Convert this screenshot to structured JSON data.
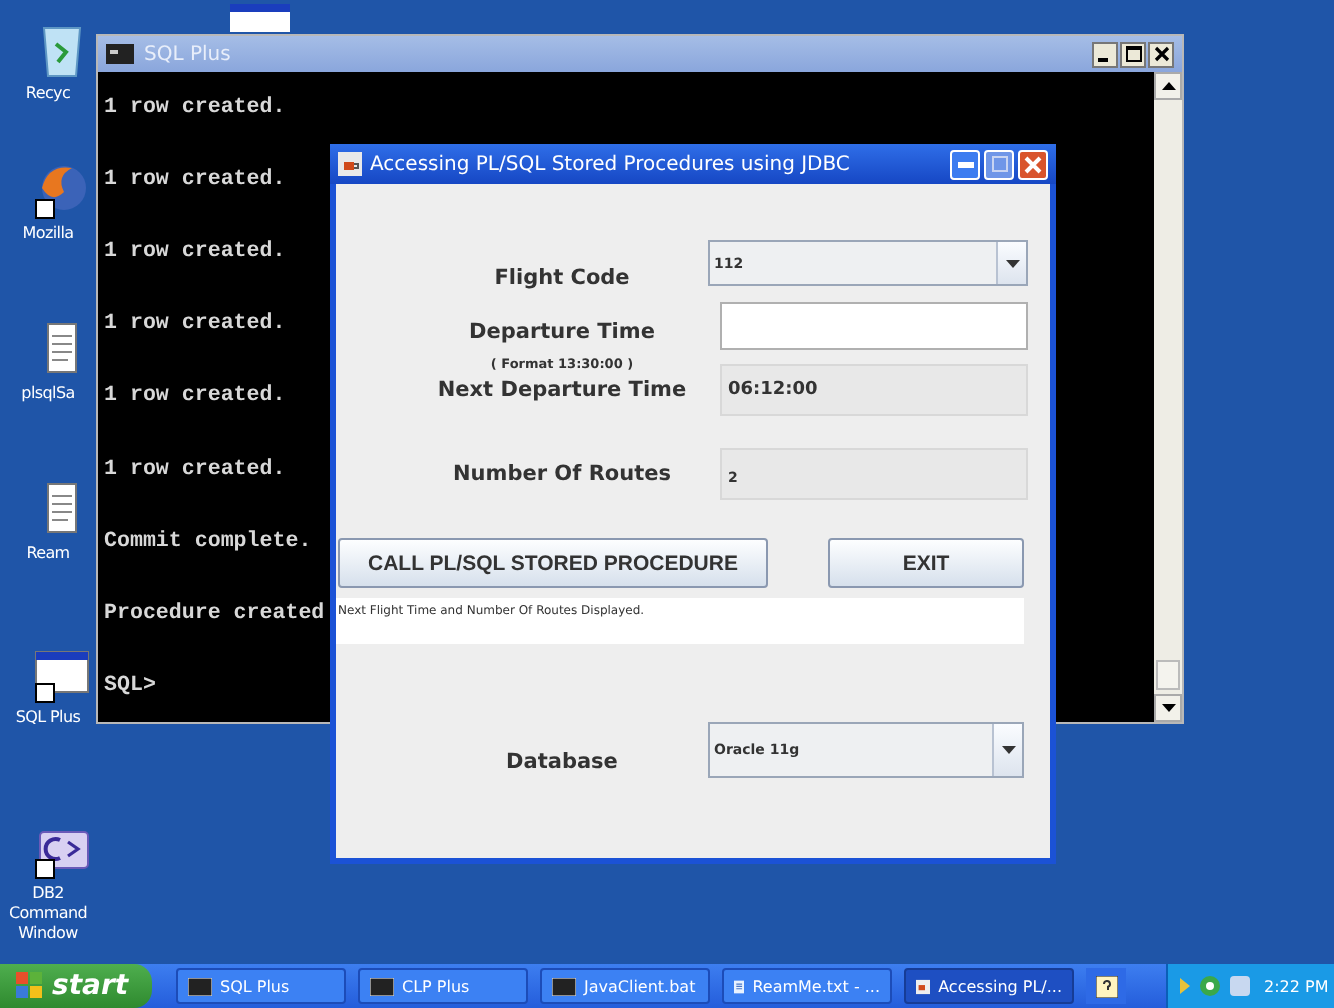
{
  "desktop_icons": [
    {
      "kind": "bin",
      "label": "Recyc"
    },
    {
      "kind": "browser",
      "label": "Mozilla"
    },
    {
      "kind": "document",
      "label": "plsqlSa"
    },
    {
      "kind": "document",
      "label": "Ream"
    },
    {
      "kind": "window",
      "label": "SQL Plus"
    },
    {
      "kind": "command",
      "label": "DB2 Command Window"
    }
  ],
  "console_window": {
    "title": "SQL Plus",
    "lines": [
      "1 row created.",
      "1 row created.",
      "1 row created.",
      "1 row created.",
      "1 row created.",
      "1 row created.",
      "Commit complete.",
      "Procedure created",
      "SQL>"
    ]
  },
  "dialog": {
    "title": "Accessing PL/SQL Stored Procedures using JDBC",
    "fields": [
      {
        "kind": "combo",
        "label": "Flight Code",
        "value": "112"
      },
      {
        "kind": "input",
        "label": "Departure Time",
        "hint": "( Format 13:30:00 )"
      },
      {
        "kind": "readonly",
        "label": "Next Departure Time",
        "value": "06:12:00"
      },
      {
        "kind": "readonly",
        "label": "Number Of Routes",
        "value": "2"
      }
    ],
    "buttons": [
      "CALL PL/SQL STORED PROCEDURE",
      "EXIT"
    ],
    "status_message": "Next Flight Time and Number Of Routes Displayed.",
    "database": {
      "label": "Database",
      "value": "Oracle 11g"
    }
  },
  "taskbar": {
    "start_label": "start",
    "items": [
      {
        "kind": "console",
        "label": "SQL Plus",
        "selected": false
      },
      {
        "kind": "console",
        "label": "CLP Plus",
        "selected": false
      },
      {
        "kind": "console",
        "label": "JavaClient.bat",
        "selected": false
      },
      {
        "kind": "notepad",
        "label": "ReamMe.txt - ...",
        "selected": false
      },
      {
        "kind": "java",
        "label": "Accessing PL/...",
        "selected": true
      }
    ],
    "clock": "2:22 PM"
  }
}
